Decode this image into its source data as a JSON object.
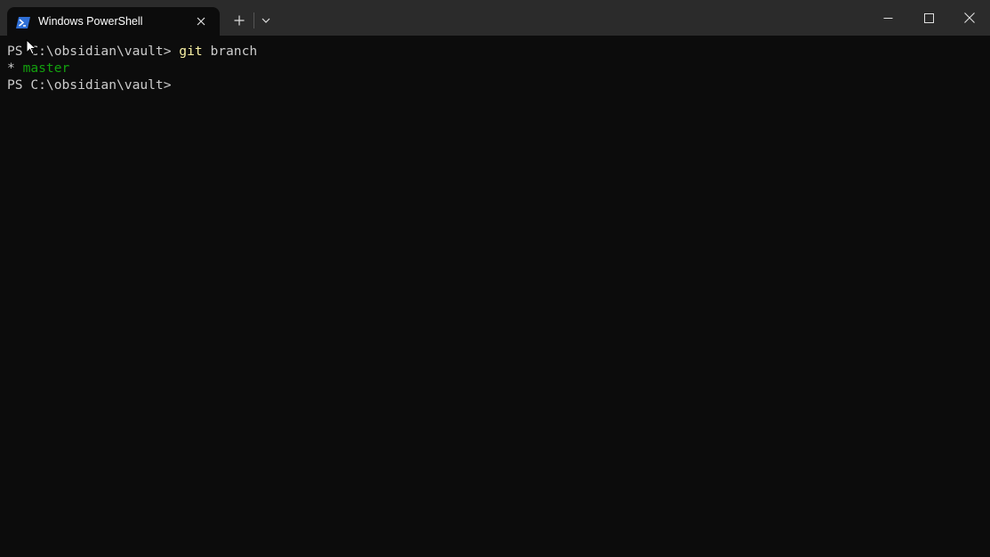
{
  "window": {
    "tab_title": "Windows PowerShell",
    "tab_icon": "powershell-icon",
    "new_tab_icon": "plus-icon",
    "dropdown_icon": "chevron-down-icon",
    "minimize_icon": "minimize-icon",
    "maximize_icon": "maximize-icon",
    "close_icon": "close-icon"
  },
  "terminal": {
    "lines": [
      {
        "prompt": "PS C:\\obsidian\\vault> ",
        "command": "git",
        "args": " branch"
      },
      {
        "bullet": "* ",
        "branch": "master"
      },
      {
        "prompt": "PS C:\\obsidian\\vault>",
        "command": "",
        "args": ""
      }
    ]
  },
  "colors": {
    "background": "#0c0c0c",
    "titlebar": "#2b2b2b",
    "text": "#cccccc",
    "command_highlight": "#f9f1a5",
    "branch_current": "#13a10e"
  }
}
